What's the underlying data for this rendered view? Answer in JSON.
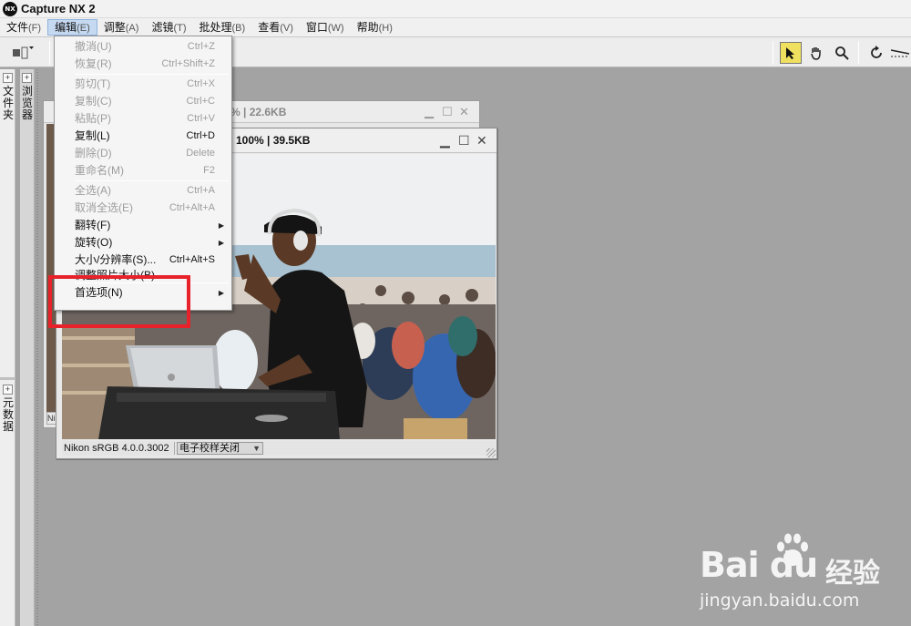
{
  "app": {
    "logo_text": "NX",
    "title": "Capture NX 2"
  },
  "menubar": {
    "items": [
      {
        "label": "文件",
        "acc": "(F)"
      },
      {
        "label": "编辑",
        "acc": "(E)"
      },
      {
        "label": "调整",
        "acc": "(A)"
      },
      {
        "label": "滤镜",
        "acc": "(T)"
      },
      {
        "label": "批处理",
        "acc": "(B)"
      },
      {
        "label": "查看",
        "acc": "(V)"
      },
      {
        "label": "窗口",
        "acc": "(W)"
      },
      {
        "label": "帮助",
        "acc": "(H)"
      }
    ]
  },
  "toolbar": {
    "tools": [
      "select-arrow",
      "hand",
      "zoom",
      "rotate",
      "straighten"
    ]
  },
  "side_panels": {
    "folder_label": "文件夹",
    "browser_label": "浏览器",
    "metadata_label": "元数据",
    "expand_glyph": "+"
  },
  "back_window": {
    "title_info": "%  |  22.6KB",
    "status_fragment": "Nik"
  },
  "front_window": {
    "title_info": "100%  |  39.5KB",
    "color_profile": "Nikon sRGB 4.0.0.3002",
    "soft_proof": "电子校样关闭"
  },
  "edit_menu": {
    "items": [
      {
        "label": "撤消",
        "acc": "(U)",
        "shortcut": "Ctrl+Z",
        "enabled": false
      },
      {
        "label": "恢复",
        "acc": "(R)",
        "shortcut": "Ctrl+Shift+Z",
        "enabled": false
      },
      {
        "sep": true
      },
      {
        "label": "剪切",
        "acc": "(T)",
        "shortcut": "Ctrl+X",
        "enabled": false
      },
      {
        "label": "复制",
        "acc": "(C)",
        "shortcut": "Ctrl+C",
        "enabled": false
      },
      {
        "label": "粘贴",
        "acc": "(P)",
        "shortcut": "Ctrl+V",
        "enabled": false
      },
      {
        "label": "复制",
        "acc": "(L)",
        "shortcut": "Ctrl+D",
        "enabled": true
      },
      {
        "label": "删除",
        "acc": "(D)",
        "shortcut": "Delete",
        "enabled": false
      },
      {
        "label": "重命名",
        "acc": "(M)",
        "shortcut": "F2",
        "enabled": false
      },
      {
        "sep": true
      },
      {
        "label": "全选",
        "acc": "(A)",
        "shortcut": "Ctrl+A",
        "enabled": false
      },
      {
        "label": "取消全选",
        "acc": "(E)",
        "shortcut": "Ctrl+Alt+A",
        "enabled": false
      },
      {
        "label": "翻转",
        "acc": "(F)",
        "submenu": true,
        "enabled": true
      },
      {
        "label": "旋转",
        "acc": "(O)",
        "submenu": true,
        "enabled": true
      },
      {
        "label": "大小/分辨率",
        "acc": "(S)...",
        "shortcut": "Ctrl+Alt+S",
        "enabled": true
      },
      {
        "label": "调整照片大小",
        "acc": "(B)...",
        "enabled": true,
        "cut": true
      },
      {
        "sep": true
      },
      {
        "label": "首选项",
        "acc": "(N)",
        "submenu": true,
        "enabled": true
      }
    ]
  },
  "watermark": {
    "logo": "Bai  du",
    "brand_cn": "经验",
    "url": "jingyan.baidu.com"
  },
  "colors": {
    "highlight": "#e8212b",
    "workspace": "#a3a3a3",
    "active_menu": "#c5d9f1",
    "active_tool": "#f0e060"
  }
}
